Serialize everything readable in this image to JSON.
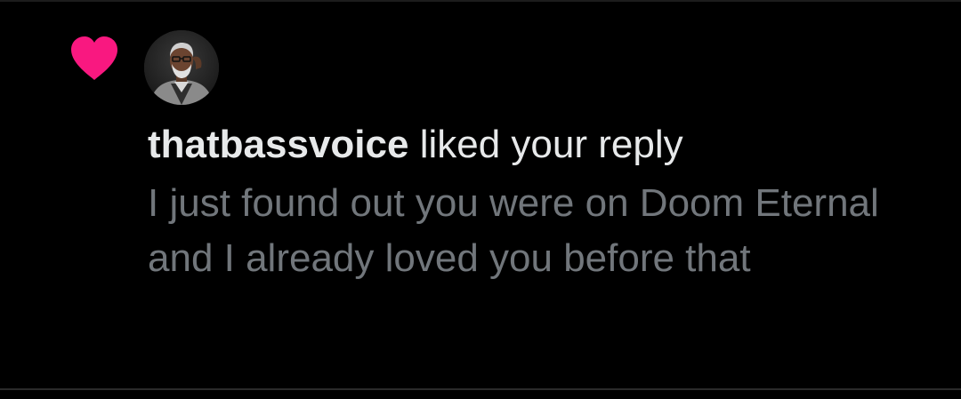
{
  "notification": {
    "type_icon": "heart-icon",
    "icon_color": "#f91880",
    "avatar": "user-avatar",
    "username": "thatbassvoice",
    "action_text": " liked your reply",
    "reply_text": "I just found out you were on Doom Eternal and I already loved you before that"
  }
}
